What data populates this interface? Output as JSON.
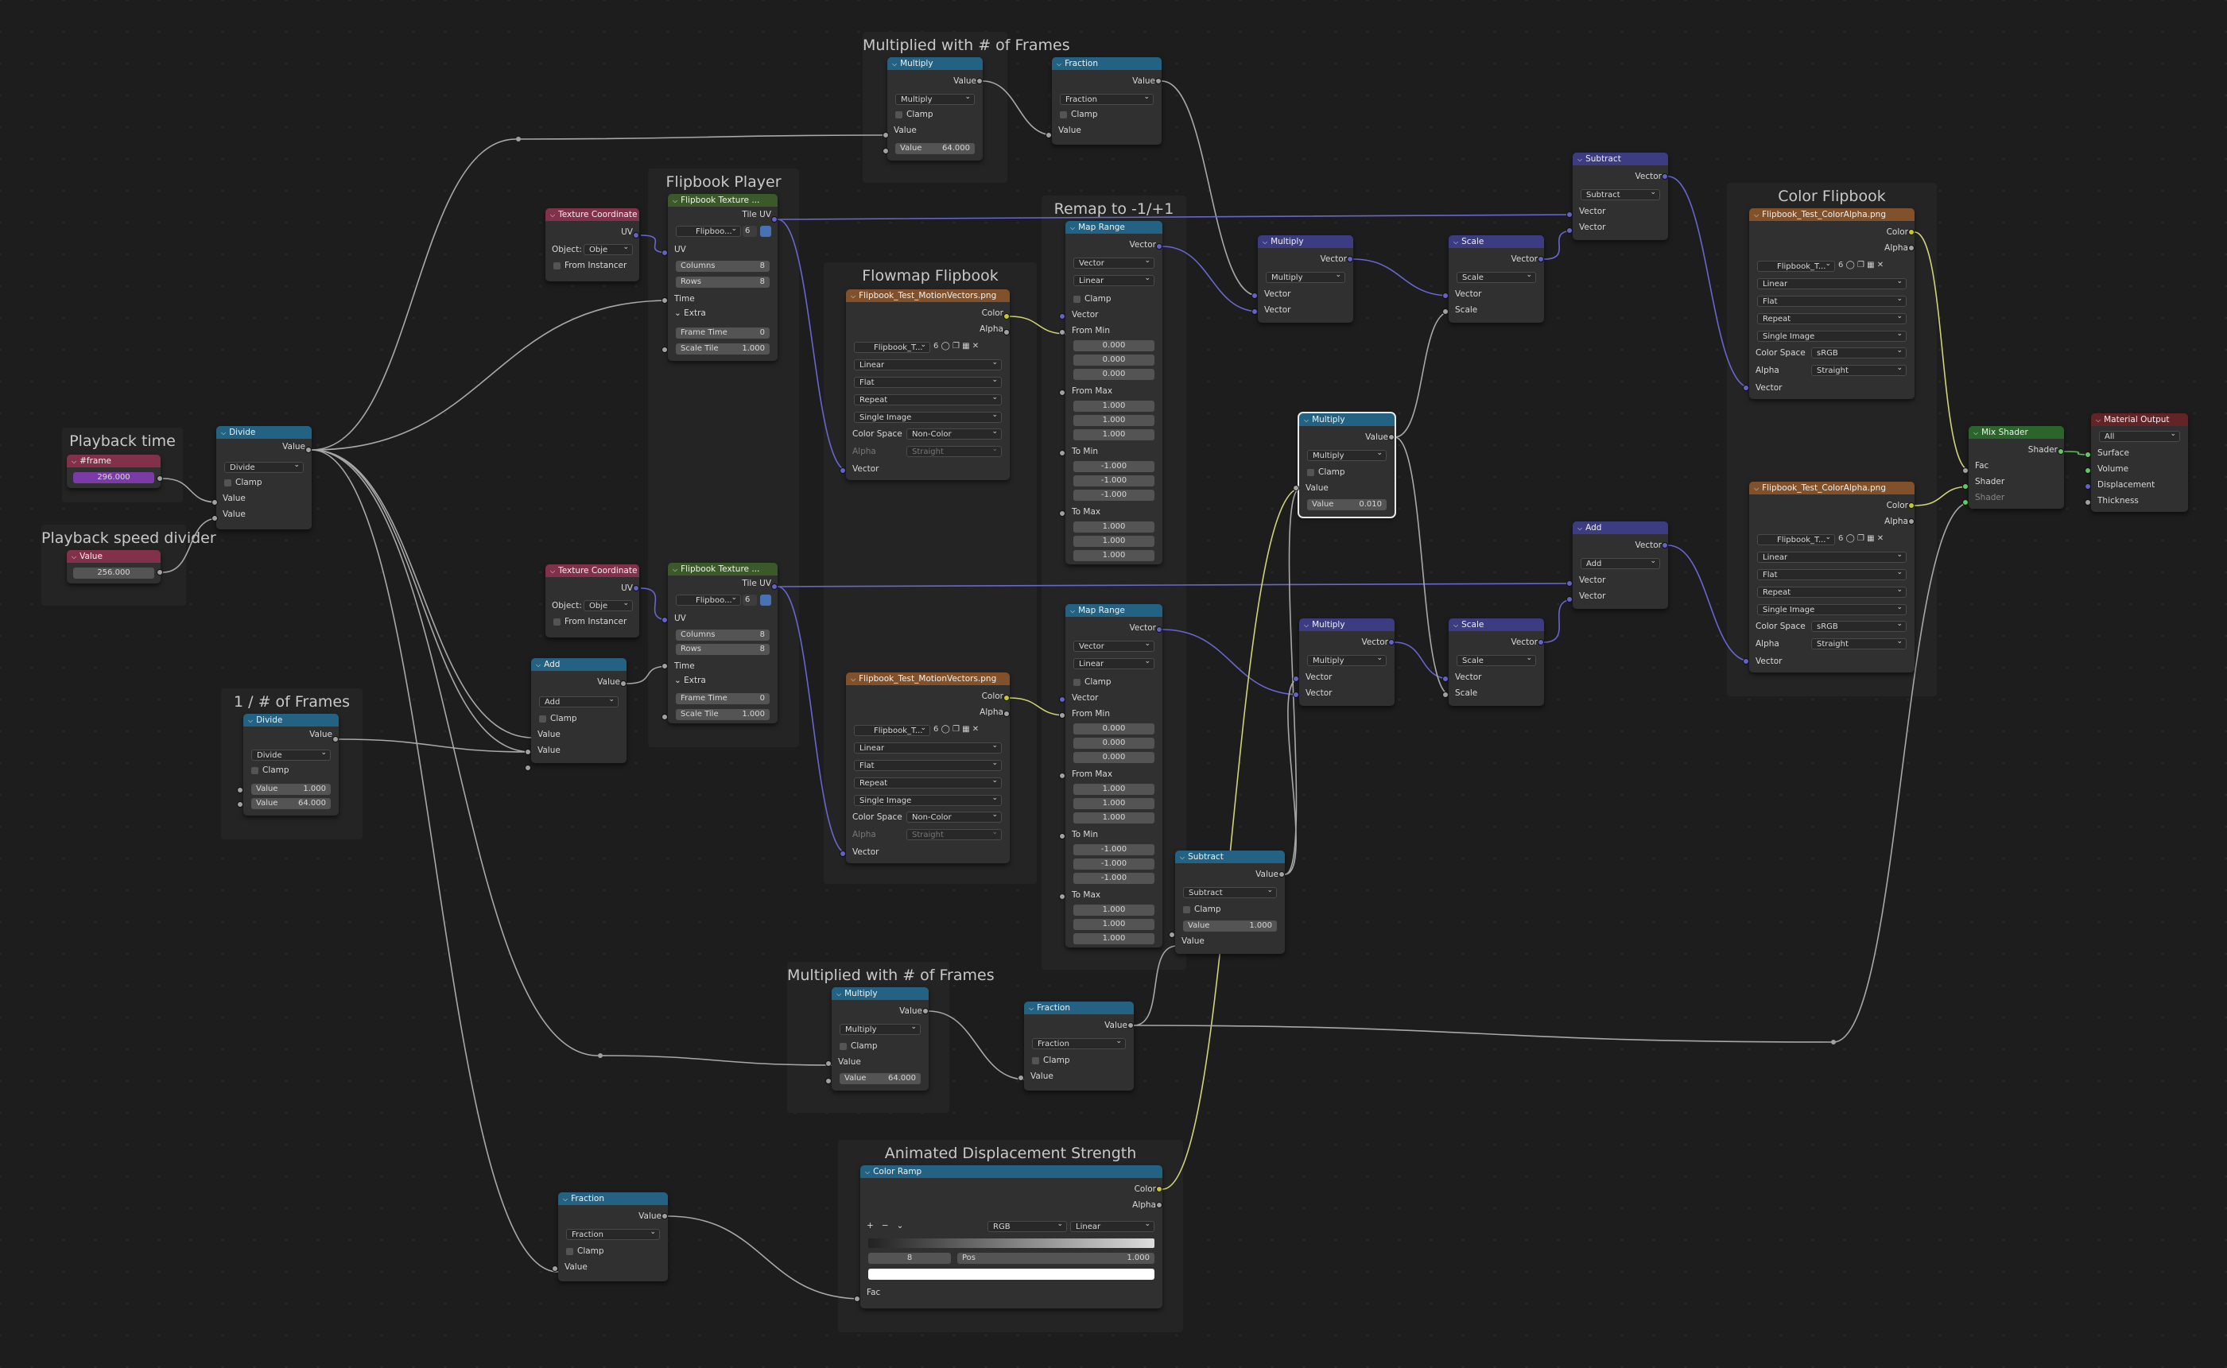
{
  "frames": {
    "playback_time": "Playback time",
    "speed_divider": "Playback speed divider",
    "frames_div": "1 / # of Frames",
    "mult_top": "Multiplied with # of Frames",
    "flip_player": "Flipbook Player",
    "remap": "Remap to -1/+1",
    "flowmap": "Flowmap Flipbook",
    "color_flipbook": "Color Flipbook",
    "mult_bottom": "Multiplied with # of Frames",
    "anim_disp": "Animated Displacement Strength"
  },
  "labels": {
    "value": "Value",
    "clamp": "Clamp",
    "vector": "Vector",
    "color": "Color",
    "alpha": "Alpha",
    "uv": "UV",
    "tile_uv": "Tile UV",
    "time": "Time",
    "extra": "Extra",
    "columns": "Columns",
    "rows": "Rows",
    "frame_time": "Frame Time",
    "scale_tile": "Scale Tile",
    "object": "Object:",
    "from_instancer": "From Instancer",
    "from_min": "From Min",
    "from_max": "From Max",
    "to_min": "To Min",
    "to_max": "To Max",
    "scale": "Scale",
    "color_space": "Color Space",
    "fac": "Fac",
    "shader": "Shader",
    "surface": "Surface",
    "volume": "Volume",
    "displacement": "Displacement",
    "thickness": "Thickness",
    "pos": "Pos"
  },
  "nodes": {
    "frame_value": {
      "title": "#frame",
      "value": "296.000"
    },
    "speed_value": {
      "title": "Value",
      "value": "256.000"
    },
    "divide1": {
      "title": "Divide",
      "op": "Divide"
    },
    "divide2": {
      "title": "Divide",
      "op": "Divide",
      "v1": "1.000",
      "v2": "64.000"
    },
    "mult_top": {
      "title": "Multiply",
      "op": "Multiply",
      "v": "64.000"
    },
    "fraction_top": {
      "title": "Fraction",
      "op": "Fraction"
    },
    "texcoord1": {
      "title": "Texture Coordinate",
      "obj": "Obje"
    },
    "texcoord2": {
      "title": "Texture Coordinate",
      "obj": "Obje"
    },
    "flip1": {
      "title": "Flipbook Texture ...",
      "img": "Flipboo...",
      "users": "6",
      "cols": "8",
      "rows": "8",
      "ft": "0",
      "st": "1.000"
    },
    "flip2": {
      "title": "Flipbook Texture ...",
      "img": "Flipboo...",
      "users": "6",
      "cols": "8",
      "rows": "8",
      "ft": "0",
      "st": "1.000"
    },
    "add1": {
      "title": "Add",
      "op": "Add"
    },
    "mv1": {
      "title": "Flipbook_Test_MotionVectors.png",
      "img": "Flipbook_T...",
      "users": "6",
      "interp": "Linear",
      "proj": "Flat",
      "ext": "Repeat",
      "src": "Single Image",
      "cs": "Non-Color",
      "alpha": "Straight"
    },
    "mv2": {
      "title": "Flipbook_Test_MotionVectors.png",
      "img": "Flipbook_T...",
      "users": "6",
      "interp": "Linear",
      "proj": "Flat",
      "ext": "Repeat",
      "src": "Single Image",
      "cs": "Non-Color",
      "alpha": "Straight"
    },
    "maprange1": {
      "title": "Map Range",
      "type": "Vector",
      "interp": "Linear",
      "fmin": [
        "0.000",
        "0.000",
        "0.000"
      ],
      "fmax": [
        "1.000",
        "1.000",
        "1.000"
      ],
      "tmin": [
        "-1.000",
        "-1.000",
        "-1.000"
      ],
      "tmax": [
        "1.000",
        "1.000",
        "1.000"
      ]
    },
    "maprange2": {
      "title": "Map Range",
      "type": "Vector",
      "interp": "Linear",
      "fmin": [
        "0.000",
        "0.000",
        "0.000"
      ],
      "fmax": [
        "1.000",
        "1.000",
        "1.000"
      ],
      "tmin": [
        "-1.000",
        "-1.000",
        "-1.000"
      ],
      "tmax": [
        "1.000",
        "1.000",
        "1.000"
      ]
    },
    "vmul1": {
      "title": "Multiply",
      "op": "Multiply"
    },
    "vmul2": {
      "title": "Multiply",
      "op": "Multiply"
    },
    "mathmul_sel": {
      "title": "Multiply",
      "op": "Multiply",
      "v": "0.010"
    },
    "scale1": {
      "title": "Scale",
      "op": "Scale"
    },
    "scale2": {
      "title": "Scale",
      "op": "Scale"
    },
    "subtract_v": {
      "title": "Subtract",
      "op": "Subtract"
    },
    "add_v": {
      "title": "Add",
      "op": "Add"
    },
    "subtract_m": {
      "title": "Subtract",
      "op": "Subtract",
      "v": "1.000"
    },
    "ca1": {
      "title": "Flipbook_Test_ColorAlpha.png",
      "img": "Flipbook_T...",
      "users": "6",
      "interp": "Linear",
      "proj": "Flat",
      "ext": "Repeat",
      "src": "Single Image",
      "cs": "sRGB",
      "alpha": "Straight"
    },
    "ca2": {
      "title": "Flipbook_Test_ColorAlpha.png",
      "img": "Flipbook_T...",
      "users": "6",
      "interp": "Linear",
      "proj": "Flat",
      "ext": "Repeat",
      "src": "Single Image",
      "cs": "sRGB",
      "alpha": "Straight"
    },
    "mix": {
      "title": "Mix Shader"
    },
    "out": {
      "title": "Material Output",
      "target": "All"
    },
    "mult_bottom": {
      "title": "Multiply",
      "op": "Multiply",
      "v": "64.000"
    },
    "fraction_bottom": {
      "title": "Fraction",
      "op": "Fraction"
    },
    "fraction_low": {
      "title": "Fraction",
      "op": "Fraction"
    },
    "ramp": {
      "title": "Color Ramp",
      "mode": "RGB",
      "interp": "Linear",
      "index": "8",
      "pos": "1.000"
    }
  },
  "colors": {
    "wire_gray": "#a8a8a8",
    "wire_vec": "#6767d0",
    "wire_yellow": "#d2d27a",
    "wire_green": "#5fb85f"
  }
}
